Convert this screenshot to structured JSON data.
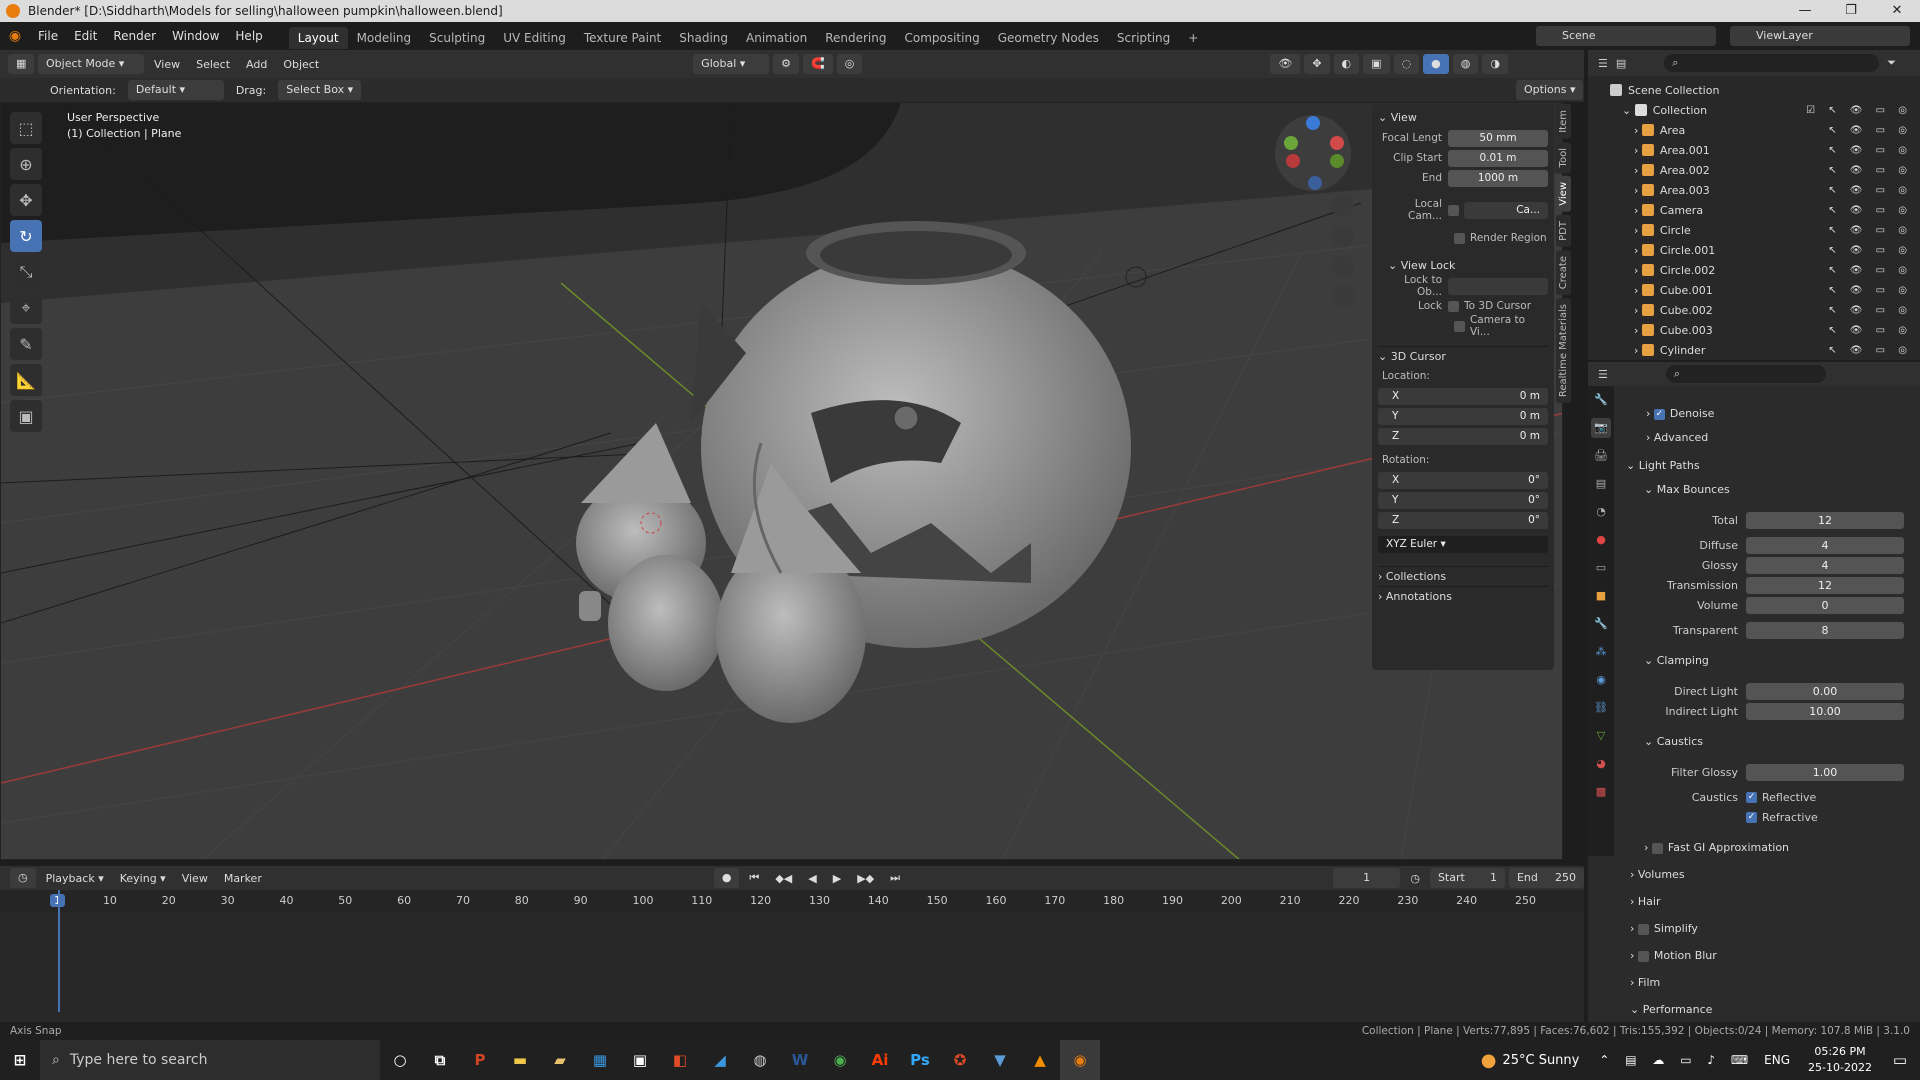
{
  "window": {
    "title": "Blender* [D:\\Siddharth\\Models for selling\\halloween pumpkin\\halloween.blend]",
    "min": "—",
    "max": "❐",
    "close": "✕"
  },
  "menu": {
    "items": [
      "File",
      "Edit",
      "Render",
      "Window",
      "Help"
    ],
    "workspaces": [
      "Layout",
      "Modeling",
      "Sculpting",
      "UV Editing",
      "Texture Paint",
      "Shading",
      "Animation",
      "Rendering",
      "Compositing",
      "Geometry Nodes",
      "Scripting",
      "+"
    ],
    "scene": "Scene",
    "view_layer": "ViewLayer"
  },
  "header": {
    "mode": "Object Mode",
    "view": "View",
    "select": "Select",
    "add": "Add",
    "object": "Object",
    "transform": "Global",
    "options": "Options"
  },
  "subheader": {
    "orientation_label": "Orientation:",
    "orientation": "Default",
    "drag_label": "Drag:",
    "drag": "Select Box"
  },
  "viewport": {
    "line1": "User Perspective",
    "line2": "(1) Collection | Plane"
  },
  "npanel": {
    "view_title": "View",
    "focal_label": "Focal Lengt",
    "focal": "50 mm",
    "clip_start_label": "Clip Start",
    "clip_start": "0.01 m",
    "end_label": "End",
    "end": "1000 m",
    "local_cam_label": "Local Cam...",
    "local_cam": "Ca...",
    "render_region": "Render Region",
    "view_lock": "View Lock",
    "lock_to_label": "Lock to Ob...",
    "lock_label": "Lock",
    "to_cursor": "To 3D Cursor",
    "camera_to": "Camera to Vi...",
    "cursor_title": "3D Cursor",
    "location": "Location:",
    "rotation": "Rotation:",
    "x": "X",
    "y": "Y",
    "z": "Z",
    "loc_x": "0 m",
    "loc_y": "0 m",
    "loc_z": "0 m",
    "rot_x": "0°",
    "rot_y": "0°",
    "rot_z": "0°",
    "euler": "XYZ Euler",
    "collections": "Collections",
    "annotations": "Annotations"
  },
  "side_tabs": [
    "Item",
    "Tool",
    "View",
    "PDT",
    "Create",
    "Realtime Materials"
  ],
  "outliner": {
    "root": "Scene Collection",
    "collection": "Collection",
    "items": [
      {
        "name": "Area",
        "color": "#e8a040"
      },
      {
        "name": "Area.001",
        "color": "#e8a040"
      },
      {
        "name": "Area.002",
        "color": "#e8a040"
      },
      {
        "name": "Area.003",
        "color": "#e8a040"
      },
      {
        "name": "Camera",
        "color": "#e8a040"
      },
      {
        "name": "Circle",
        "color": "#e8a040"
      },
      {
        "name": "Circle.001",
        "color": "#e8a040"
      },
      {
        "name": "Circle.002",
        "color": "#e8a040"
      },
      {
        "name": "Cube.001",
        "color": "#e8a040"
      },
      {
        "name": "Cube.002",
        "color": "#e8a040"
      },
      {
        "name": "Cube.003",
        "color": "#e8a040"
      },
      {
        "name": "Cylinder",
        "color": "#e8a040"
      }
    ]
  },
  "properties": {
    "denoise": "Denoise",
    "advanced": "Advanced",
    "light_paths": "Light Paths",
    "max_bounces": "Max Bounces",
    "total_l": "Total",
    "total": "12",
    "diffuse_l": "Diffuse",
    "diffuse": "4",
    "glossy_l": "Glossy",
    "glossy": "4",
    "transmission_l": "Transmission",
    "transmission": "12",
    "volume_l": "Volume",
    "volume": "0",
    "transparent_l": "Transparent",
    "transparent": "8",
    "clamping": "Clamping",
    "direct_l": "Direct Light",
    "direct": "0.00",
    "indirect_l": "Indirect Light",
    "indirect": "10.00",
    "caustics": "Caustics",
    "filter_glossy_l": "Filter Glossy",
    "filter_glossy": "1.00",
    "caustics_l": "Caustics",
    "reflective": "Reflective",
    "refractive": "Refractive",
    "fast_gi": "Fast GI Approximation",
    "volumes": "Volumes",
    "hair": "Hair",
    "simplify": "Simplify",
    "motion_blur": "Motion Blur",
    "film": "Film",
    "performance": "Performance"
  },
  "timeline": {
    "playback": "Playback",
    "keying": "Keying",
    "view": "View",
    "marker": "Marker",
    "current": "1",
    "start_l": "Start",
    "start": "1",
    "end_l": "End",
    "end": "250",
    "ticks": [
      "1",
      "10",
      "20",
      "30",
      "40",
      "50",
      "60",
      "70",
      "80",
      "90",
      "100",
      "110",
      "120",
      "130",
      "140",
      "150",
      "160",
      "170",
      "180",
      "190",
      "200",
      "210",
      "220",
      "230",
      "240",
      "250"
    ]
  },
  "status": {
    "left": "Axis Snap",
    "right": "Collection | Plane | Verts:77,895 | Faces:76,602 | Tris:155,392 | Objects:0/24 | Memory: 107.8 MiB | 3.1.0"
  },
  "taskbar": {
    "search": "Type here to search",
    "weather": "25°C  Sunny",
    "lang": "ENG",
    "time": "05:26 PM",
    "date": "25-10-2022"
  }
}
